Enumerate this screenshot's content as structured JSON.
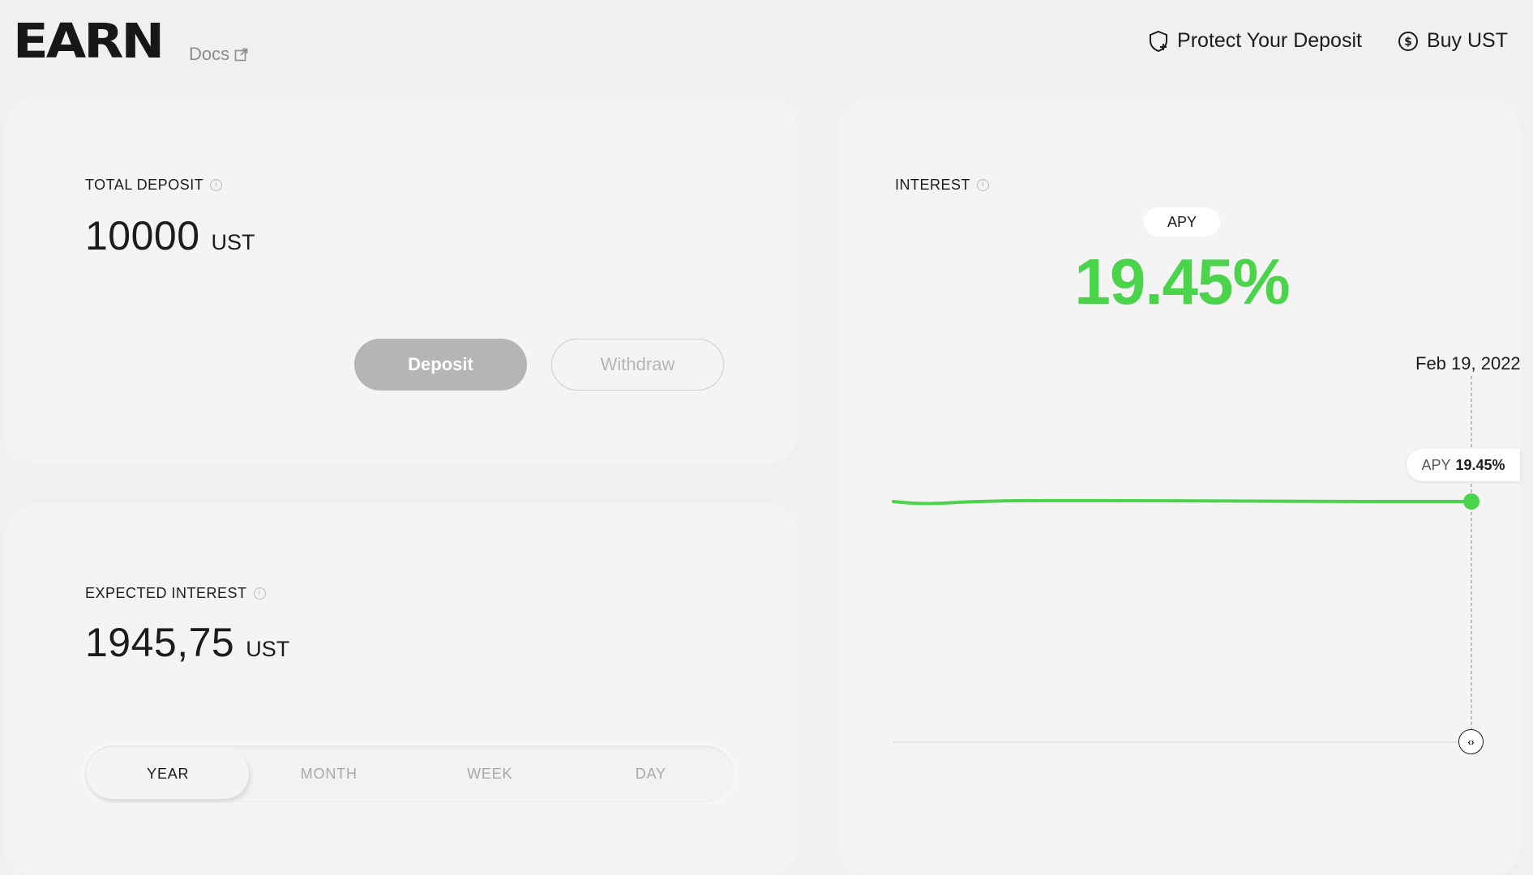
{
  "header": {
    "brand": "EARN",
    "docs_label": "Docs",
    "actions": [
      {
        "label": "Protect Your Deposit",
        "icon": "shield-plus-icon"
      },
      {
        "label": "Buy UST",
        "icon": "dollar-coin-icon"
      }
    ]
  },
  "total_deposit": {
    "label": "TOTAL DEPOSIT",
    "value": "10000",
    "unit": "UST",
    "deposit_label": "Deposit",
    "withdraw_label": "Withdraw"
  },
  "expected_interest": {
    "label": "EXPECTED INTEREST",
    "value": "1945,75",
    "unit": "UST",
    "periods": [
      "YEAR",
      "MONTH",
      "WEEK",
      "DAY"
    ],
    "selected_period": "YEAR"
  },
  "interest": {
    "label": "INTEREST",
    "apy_pill": "APY",
    "apy_value": "19.45%",
    "chart_date": "Feb 19, 2022",
    "tooltip_label": "APY",
    "tooltip_value": "19.45%",
    "line_color": "#4bd44b"
  },
  "colors": {
    "accent_green": "#4bd44b",
    "disabled_button": "#b5b5b5",
    "background": "#f0f0f0"
  }
}
